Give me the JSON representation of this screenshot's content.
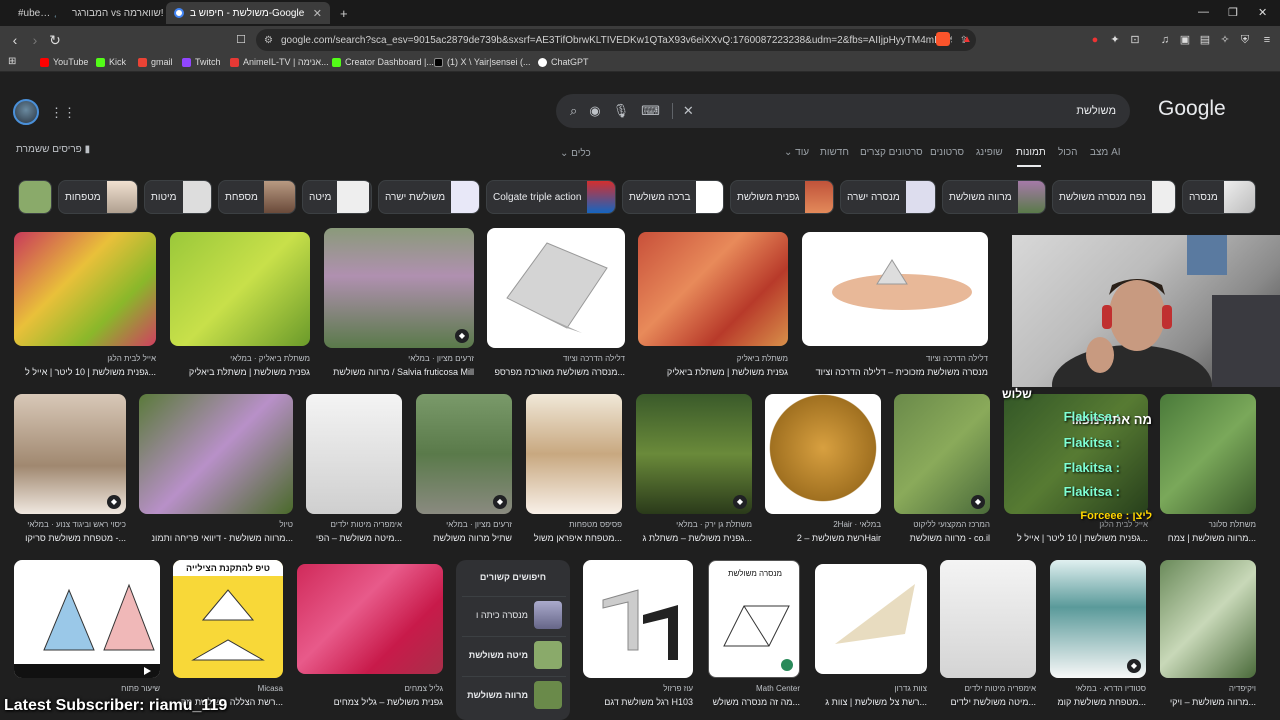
{
  "browser": {
    "tabs": [
      {
        "label": "#ube… 🎵",
        "icon": "youtube"
      },
      {
        "label": "המבורגר vs שווארמה!!",
        "icon": "page"
      },
      {
        "label": "משולשת - חיפוש ב-Google",
        "icon": "google",
        "active": true
      }
    ],
    "new_tab": "+",
    "url": "google.com/search?sca_esv=9015ac2879de739b&sxsrf=AE3TifObrwKLTIVEDKw1QTaX93v6eiXXvQ:1760087223238&udm=2&fbs=AIIjpHyyTM4mIKw5…",
    "bookmarks": [
      {
        "label": "YouTube",
        "color": "#ff0000"
      },
      {
        "label": "Kick",
        "color": "#53fc18"
      },
      {
        "label": "gmail",
        "color": "#ea4335"
      },
      {
        "label": "Twitch",
        "color": "#9146ff"
      },
      {
        "label": "AnimeIL-TV | אנימה...",
        "color": "#e53935"
      },
      {
        "label": "Creator Dashboard |...",
        "color": "#53fc18"
      },
      {
        "label": "(1) X \\ Yair|sensei (...",
        "color": "#000000"
      },
      {
        "label": "ChatGPT",
        "color": "#ffffff"
      }
    ]
  },
  "search": {
    "query": "משולשת",
    "logo": "Google",
    "safesearch": "פריסים ששמרת",
    "tools": "כלים",
    "tabs": [
      "מצב AI",
      "הכול",
      "תמונות",
      "שופינג",
      "סרטונים",
      "סרטונים קצרים",
      "חדשות",
      "עוד"
    ]
  },
  "chips": [
    "מנסרה",
    "נפח מנסרה משולשת",
    "מרווה משולשת",
    "מנסרה ישרה",
    "גפנית משולשת",
    "ברכה משולשת",
    "Colgate triple action",
    "משולשת ישרה",
    "מיטה",
    "מספחת",
    "מיטות",
    "מטפחות"
  ],
  "results_row1": [
    {
      "cap": "גפנית משולשת | 10 ליטר | אייל ל...",
      "src": "אייל לבית הלגן"
    },
    {
      "cap": "גפנית משולשת | משתלת ביאליק",
      "src": "משתלת ביאליק · במלאי"
    },
    {
      "cap": "מרווה משולשת / Salvia fruticosa Mill",
      "src": "זרעים מציון · במלאי"
    },
    {
      "cap": "מנסרה משולשת מאורכת מפרספ...",
      "src": "דלילה הדרכה וציוד"
    },
    {
      "cap": "גפנית משולשת | משתלת ביאליק",
      "src": "משתלת ביאליק"
    },
    {
      "cap": "מנסרה משולשת מזכוכית – דלילה הדרכה וציוד",
      "src": "דלילה הדרכה וציוד"
    }
  ],
  "results_row2": [
    {
      "cap": "מטפחת משולשת סריקו -...",
      "src": "כיסוי ראש וביגוד צנוע · במלאי"
    },
    {
      "cap": "מרווה משולשת - דיוואי פריחה ותמונ...",
      "src": "טיול"
    },
    {
      "cap": "מיטה משולשת – הפי...",
      "src": "אימפריה מיטות ילדים"
    },
    {
      "cap": "שתיל מרווה משולשת",
      "src": "זרעים מציון · במלאי"
    },
    {
      "cap": "מטפחת איפראן משול...",
      "src": "פסיפס מטפחות"
    },
    {
      "cap": "גפנית משולשת – משתלת ג...",
      "src": "משתלת גן ירק · במלאי"
    },
    {
      "cap": "רשת משולשת – 2Hair",
      "src": "2Hair · במלאי"
    },
    {
      "cap": "מרווה משולשת - co.il",
      "src": "המרכז המקצועי לליקוט"
    },
    {
      "cap": "גפנית משולשת | 10 ליטר | אייל ל...",
      "src": "אייל לבית הלגן"
    },
    {
      "cap": "מרווה משולשת | צמח...",
      "src": "משתלת סלונר"
    }
  ],
  "results_row3": [
    {
      "cap": "",
      "src": "שיעור פתוח"
    },
    {
      "cap": "רשת הצללה משולשת מק...",
      "src": "Micasa"
    },
    {
      "cap": "גפנית משולשת – גליל צמחים",
      "src": "גליל צמחים"
    },
    {
      "cap": "רגל משולשת דגם H103",
      "src": "עוז פרזול"
    },
    {
      "cap": "מה זה מנסרה משולש...",
      "src": "Math Center"
    },
    {
      "cap": "רשת צל משולשת | צוות ג...",
      "src": "צוות גדרון"
    },
    {
      "cap": "מיטה משולשת ילדים...",
      "src": "אימפריה מיטות ילדים"
    },
    {
      "cap": "מטפחת משולשת קומ...",
      "src": "סטודיו הדרא · במלאי"
    },
    {
      "cap": "מרווה משולשת – ויקי...",
      "src": "ויקיפדיה"
    }
  ],
  "related": {
    "title": "חיפושים קשורים",
    "items": [
      "מנסרה כיתה ו",
      "מיטה משולשת",
      "מרווה משולשת"
    ]
  },
  "thumb_texts": {
    "sail_title": "טיפ להתקנת הצילייה",
    "prism_label": "מנסרה משולשת"
  },
  "overlay": {
    "chat_header": "מה אתה מפגר",
    "chat_header2": "שלוש",
    "chat_lines": [
      "Flakitsa :",
      "Flakitsa :",
      "Flakitsa :",
      "Flakitsa :"
    ],
    "chat_footer": "Forceee : ליצן",
    "latest_subscriber": "Latest Subscriber: riamu_119"
  }
}
